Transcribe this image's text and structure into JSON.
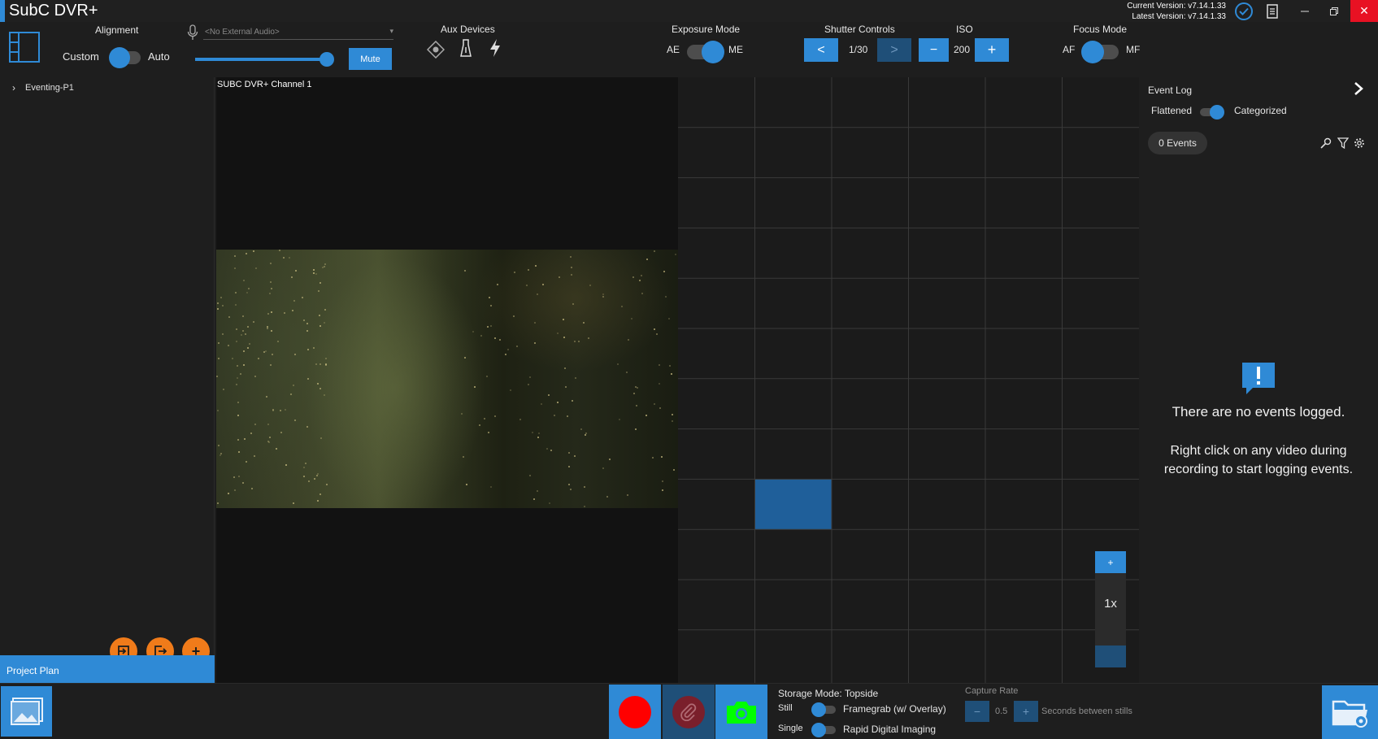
{
  "window": {
    "title": "SubC DVR+",
    "current_version": "Current Version: v7.14.1.33",
    "latest_version": "Latest Version: v7.14.1.33"
  },
  "colors": {
    "accent": "#2f8ad6",
    "orange": "#f07b1a",
    "record": "#ff0000",
    "camera": "#00ff00"
  },
  "toolbar": {
    "alignment": {
      "label": "Alignment",
      "left": "Custom",
      "right": "Auto"
    },
    "audio": {
      "placeholder": "<No External Audio>",
      "volume": 0.95,
      "mute_label": "Mute"
    },
    "aux_devices": {
      "label": "Aux Devices",
      "icons": [
        "laser-icon",
        "lamp-icon",
        "flash-icon"
      ]
    },
    "exposure": {
      "label": "Exposure Mode",
      "left": "AE",
      "right": "ME"
    },
    "shutter": {
      "label": "Shutter Controls",
      "prev": "<",
      "value": "1/30",
      "next": ">"
    },
    "iso": {
      "label": "ISO",
      "minus": "−",
      "value": "200",
      "plus": "+"
    },
    "focus": {
      "label": "Focus Mode",
      "left": "AF",
      "right": "MF"
    }
  },
  "left_panel": {
    "tree_item": "Eventing-P1",
    "project_plan": "Project Plan",
    "fab_add": "+"
  },
  "video": {
    "channel_label": "SUBC DVR+ Channel 1"
  },
  "grid": {
    "zoom_plus": "+",
    "zoom_level": "1x",
    "zoom_minus": "−"
  },
  "event_log": {
    "title": "Event Log",
    "flattened": "Flattened",
    "categorized": "Categorized",
    "events_count": "0  Events",
    "empty_title": "There are no events logged.",
    "empty_sub": "Right click on any video during recording to start logging events."
  },
  "bottom": {
    "storage_mode": "Storage Mode: Topside",
    "still": "Still",
    "framegrab": "Framegrab (w/ Overlay)",
    "single": "Single",
    "rapid": "Rapid Digital Imaging",
    "capture_rate": "Capture Rate",
    "capture_value": "0.5",
    "capture_minus": "−",
    "capture_plus": "+",
    "seconds_label": "Seconds between stills"
  }
}
